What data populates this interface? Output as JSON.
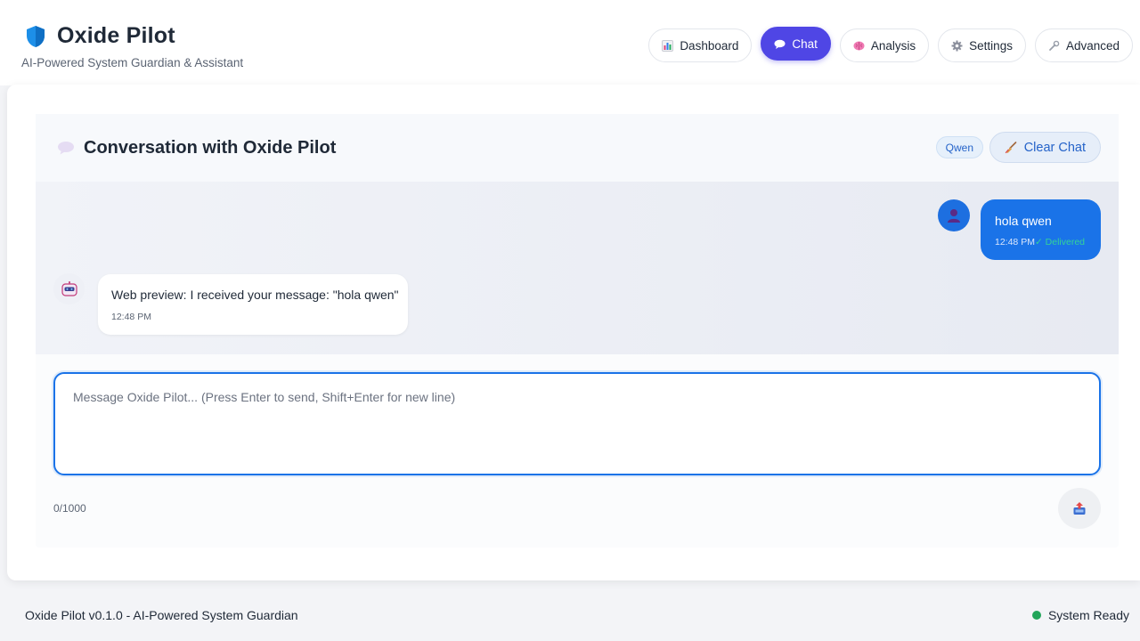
{
  "app": {
    "title": "Oxide Pilot",
    "subtitle": "AI-Powered System Guardian & Assistant",
    "brand_icon": "shield-icon",
    "accent_color": "#4f46e5"
  },
  "nav": {
    "items": [
      {
        "label": "Dashboard",
        "icon": "bar-chart-icon",
        "active": false
      },
      {
        "label": "Chat",
        "icon": "speech-bubble-icon",
        "active": true
      },
      {
        "label": "Analysis",
        "icon": "brain-icon",
        "active": false
      },
      {
        "label": "Settings",
        "icon": "gear-icon",
        "active": false
      },
      {
        "label": "Advanced",
        "icon": "wrench-icon",
        "active": false
      }
    ]
  },
  "chat": {
    "title": "Conversation with Oxide Pilot",
    "model_badge": "Qwen",
    "clear_label": "Clear Chat",
    "messages": [
      {
        "role": "user",
        "text": "hola qwen",
        "time": "12:48 PM",
        "status": "✓ Delivered"
      },
      {
        "role": "assistant",
        "text": "Web preview: I received your message: \"hola qwen\"",
        "time": "12:48 PM"
      }
    ],
    "input_placeholder": "Message Oxide Pilot... (Press Enter to send, Shift+Enter for new line)",
    "input_value": "",
    "char_count": "0/1000",
    "send_icon": "outbox-tray-icon"
  },
  "footer": {
    "version_text": "Oxide Pilot v0.1.0 - AI-Powered System Guardian",
    "status_text": "System Ready",
    "status_color": "#22a55a"
  }
}
